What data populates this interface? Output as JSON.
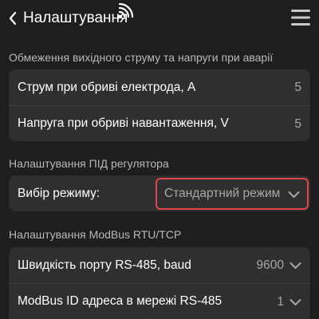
{
  "header": {
    "title": "Налаштування",
    "back_icon": "chevron-left-icon",
    "status_icon": "wifi-icon",
    "menu_icon": "hamburger-menu-icon"
  },
  "sections": {
    "limits": {
      "label": "Обмеження вихідного струму та напруги при аварії",
      "rows": [
        {
          "label": "Струм при обриві електрода, А",
          "value": "5"
        },
        {
          "label": "Напруга при обриві навантаження, V",
          "value": "5"
        }
      ]
    },
    "pid": {
      "label": "Налаштування ПІД регулятора",
      "mode_label": "Вибір режиму:",
      "mode_value": "Стандартний режим"
    },
    "modbus": {
      "label": "Налаштування ModBus RTU/TCP",
      "rows": [
        {
          "label": "Швидкість порту RS-485, baud",
          "value": "9600"
        },
        {
          "label": "ModBus ID адреса в мережі RS-485",
          "value": "1"
        }
      ]
    }
  },
  "colors": {
    "background": "#1e1e1e",
    "card": "#2f2f2f",
    "highlight": "#e0474c",
    "secondary_text": "#b9b9b9"
  }
}
